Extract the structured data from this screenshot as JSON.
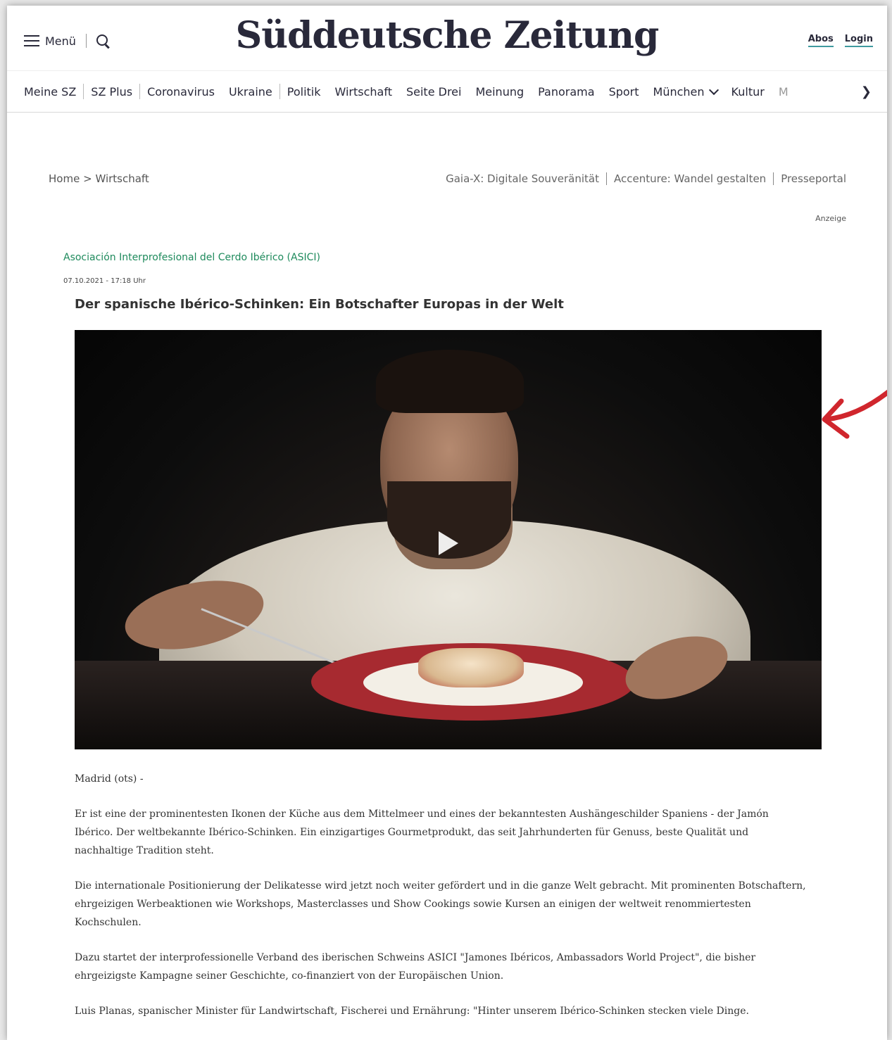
{
  "header": {
    "menu_label": "Menü",
    "logo": "Süddeutsche Zeitung",
    "abos": "Abos",
    "login": "Login"
  },
  "nav": {
    "items": [
      "Meine SZ",
      "SZ Plus",
      "Coronavirus",
      "Ukraine",
      "Politik",
      "Wirtschaft",
      "Seite Drei",
      "Meinung",
      "Panorama",
      "Sport",
      "München",
      "Kultur",
      "M"
    ]
  },
  "breadcrumb": {
    "home": "Home",
    "separator": ">",
    "section": "Wirtschaft"
  },
  "partners": [
    "Gaia-X: Digitale Souveränität",
    "Accenture: Wandel gestalten",
    "Presseportal"
  ],
  "ad_label": "Anzeige",
  "article": {
    "source": "Asociación Interprofesional del Cerdo Ibérico (ASICI)",
    "date": "07.10.2021 - 17:18 Uhr",
    "headline": "Der spanische Ibérico-Schinken: Ein Botschafter Europas in der Welt",
    "paragraphs": [
      "Madrid (ots) -",
      "Er ist eine der prominentesten Ikonen der Küche aus dem Mittelmeer und eines der bekanntesten Aushängeschilder Spaniens - der Jamón Ibérico. Der weltbekannte Ibérico-Schinken. Ein einzigartiges Gourmetprodukt, das seit Jahrhunderten für Genuss, beste Qualität und nachhaltige Tradition steht.",
      "Die internationale Positionierung der Delikatesse wird jetzt noch weiter gefördert und in die ganze Welt gebracht. Mit prominenten Botschaftern, ehrgeizigen Werbeaktionen wie Workshops, Masterclasses und Show Cookings sowie Kursen an einigen der weltweit renommiertesten Kochschulen.",
      "Dazu startet der interprofessionelle Verband des iberischen Schweins ASICI \"Jamones Ibéricos, Ambassadors World Project\", die bisher ehrgeizigste Kampagne seiner Geschichte, co-finanziert von der Europäischen Union.",
      "Luis Planas, spanischer Minister für Landwirtschaft, Fischerei und Ernährung: \"Hinter unserem Ibérico-Schinken stecken viele Dinge."
    ]
  },
  "colors": {
    "brand_text": "#29293a",
    "account_underline": "#3f9a9f",
    "source_green": "#1e8a5c",
    "annotation_red": "#d0262d"
  },
  "icons": [
    "hamburger-icon",
    "search-icon",
    "chevron-down-icon",
    "chevron-right-icon",
    "play-icon",
    "arrow-annotation"
  ]
}
